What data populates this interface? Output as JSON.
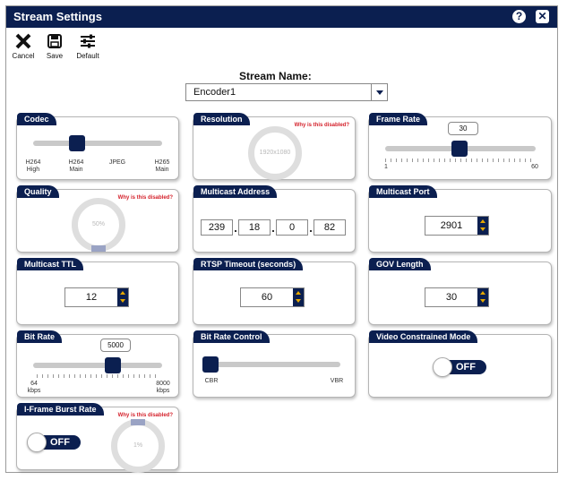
{
  "window": {
    "title": "Stream Settings",
    "help_icon": "?",
    "close_icon": "✕"
  },
  "toolbar": {
    "cancel": "Cancel",
    "save": "Save",
    "default": "Default"
  },
  "stream": {
    "label": "Stream Name:",
    "value": "Encoder1"
  },
  "why_disabled": "Why is this disabled?",
  "codec": {
    "title": "Codec",
    "options": [
      "H264\nHigh",
      "H264\nMain",
      "JPEG",
      "H265\nMain"
    ],
    "selected": "H264\nMain"
  },
  "resolution": {
    "title": "Resolution",
    "value": "1920x1080"
  },
  "frame_rate": {
    "title": "Frame Rate",
    "value": "30",
    "min": "1",
    "max": "60"
  },
  "quality": {
    "title": "Quality",
    "value": "50%"
  },
  "multicast_address": {
    "title": "Multicast Address",
    "octets": [
      "239",
      "18",
      "0",
      "82"
    ],
    "separator": "."
  },
  "multicast_port": {
    "title": "Multicast Port",
    "value": "2901"
  },
  "multicast_ttl": {
    "title": "Multicast TTL",
    "value": "12"
  },
  "rtsp_timeout": {
    "title": "RTSP Timeout (seconds)",
    "value": "60"
  },
  "gov_length": {
    "title": "GOV Length",
    "value": "30"
  },
  "bit_rate": {
    "title": "Bit Rate",
    "value": "5000",
    "min": "64\nkbps",
    "max": "8000\nkbps"
  },
  "bit_rate_control": {
    "title": "Bit Rate Control",
    "left": "CBR",
    "right": "VBR",
    "selected": "CBR"
  },
  "video_constrained": {
    "title": "Video Constrained Mode",
    "state": "OFF"
  },
  "iframe_burst": {
    "title": "I-Frame Burst Rate",
    "state": "OFF",
    "value": "1%"
  }
}
